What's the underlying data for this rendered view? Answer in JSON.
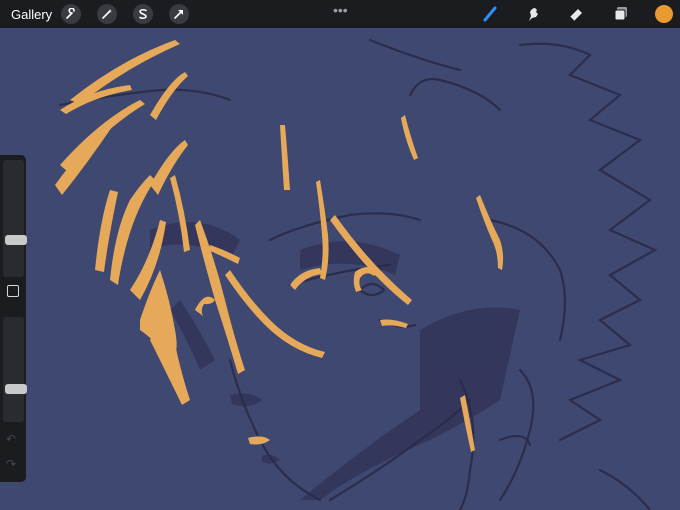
{
  "topbar": {
    "gallery_label": "Gallery",
    "actions_icons": [
      "wrench-icon",
      "magic-wand-icon",
      "selection-s-icon",
      "transform-arrow-icon"
    ],
    "more_label": "•••"
  },
  "tools": [
    "brush-icon",
    "smudge-icon",
    "eraser-icon",
    "layers-icon"
  ],
  "colors": {
    "active_color": "#e79a2f",
    "active_tool": "#2f8cff",
    "canvas_bg": "#3f4870",
    "sketch_orange": "#e6a959",
    "sketch_dark": "#2b2a4a"
  },
  "sidebar": {
    "brush_size_level": 0.3,
    "opacity_level": 0.3,
    "undo_icon": "↶",
    "redo_icon": "↷"
  }
}
